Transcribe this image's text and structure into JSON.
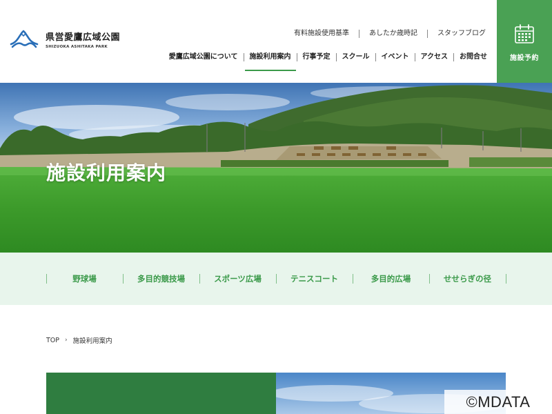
{
  "site": {
    "title": "県営愛鷹広域公園",
    "subtitle": "SHIZUOKA ASHITAKA PARK"
  },
  "utility_nav": [
    {
      "label": "有料施設使用基準"
    },
    {
      "label": "あしたか歳時記"
    },
    {
      "label": "スタッフブログ"
    }
  ],
  "global_nav": [
    {
      "label": "愛鷹広域公園について",
      "active": false
    },
    {
      "label": "施設利用案内",
      "active": true
    },
    {
      "label": "行事予定",
      "active": false
    },
    {
      "label": "スクール",
      "active": false
    },
    {
      "label": "イベント",
      "active": false
    },
    {
      "label": "アクセス",
      "active": false
    },
    {
      "label": "お問合せ",
      "active": false
    }
  ],
  "reserve": {
    "label": "施設予約",
    "icon": "calendar-icon"
  },
  "hero": {
    "title": "施設利用案内"
  },
  "sub_nav": [
    {
      "label": "野球場"
    },
    {
      "label": "多目的競技場"
    },
    {
      "label": "スポーツ広場"
    },
    {
      "label": "テニスコート"
    },
    {
      "label": "多目的広場"
    },
    {
      "label": "せせらぎの径"
    }
  ],
  "breadcrumb": {
    "home": "TOP",
    "separator": "›",
    "current": "施設利用案内"
  },
  "watermark": "©MDATA",
  "colors": {
    "brand_green": "#4aa154",
    "dark_green": "#2f7d40",
    "subnav_bg": "#e8f5ec",
    "logo_blue": "#2a6fb8"
  }
}
